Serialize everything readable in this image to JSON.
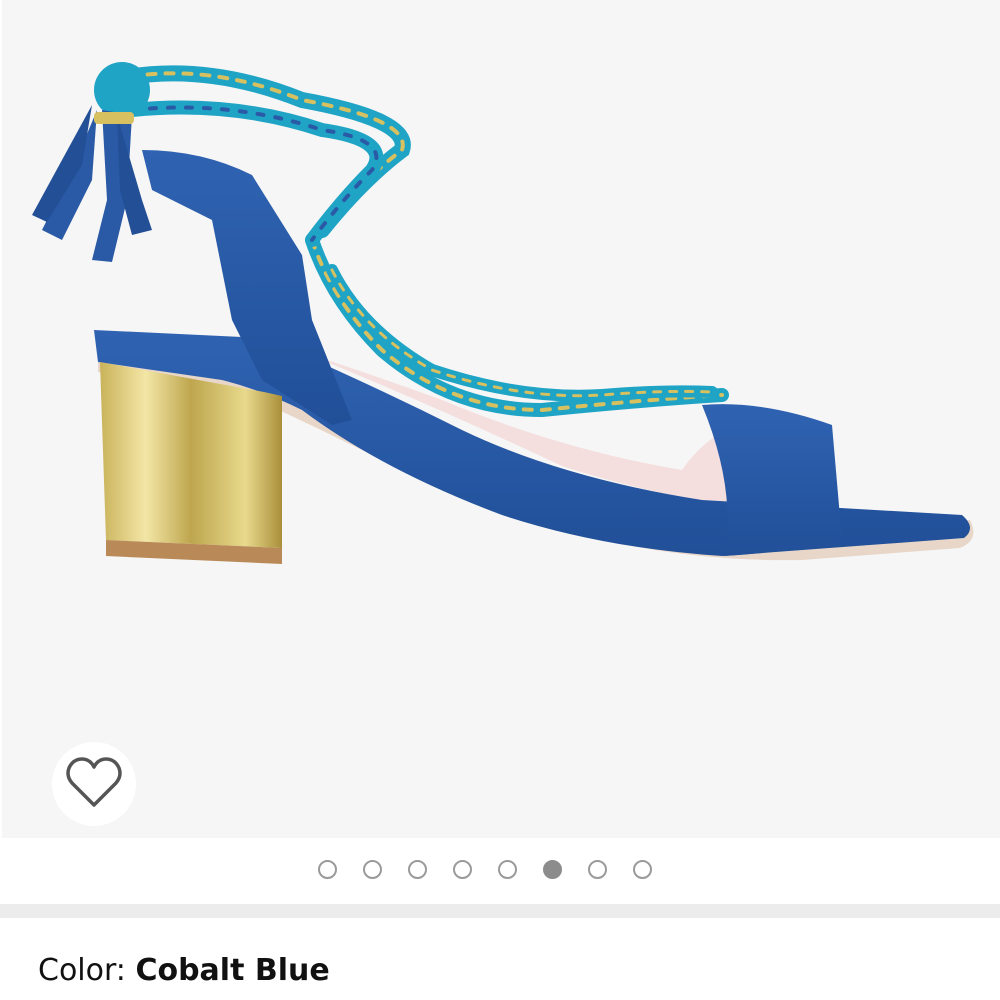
{
  "product": {
    "image_alt": "Blue suede block-heel sandal with braided ankle ties and tassel",
    "colors": {
      "suede": "#2a5aa6",
      "rope_teal": "#1fa4c6",
      "gold": "#d6c060",
      "insole": "#f4dede"
    }
  },
  "wishlist": {
    "icon": "heart-outline-icon"
  },
  "carousel": {
    "total": 8,
    "active_index": 5
  },
  "color_selector": {
    "label": "Color: ",
    "value": "Cobalt Blue"
  }
}
